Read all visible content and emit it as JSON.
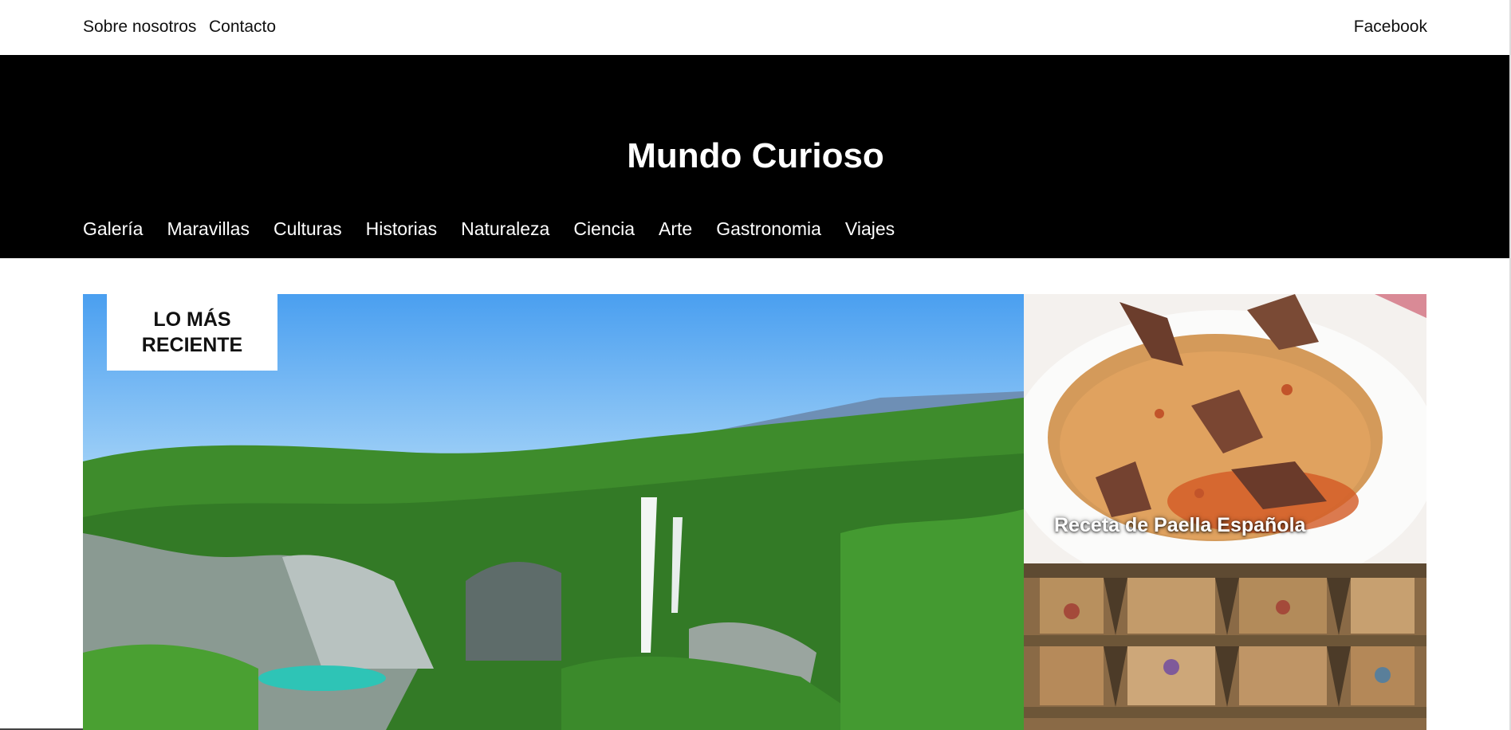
{
  "topbar": {
    "links": [
      "Sobre nosotros",
      "Contacto"
    ],
    "social": "Facebook"
  },
  "site": {
    "title": "Mundo Curioso"
  },
  "nav": [
    "Galería",
    "Maravillas",
    "Culturas",
    "Historias",
    "Naturaleza",
    "Ciencia",
    "Arte",
    "Gastronomia",
    "Viajes"
  ],
  "hero": {
    "badge": "LO MÁS RECIENTE",
    "image": "waterfall-forest-landscape"
  },
  "cards": [
    {
      "caption": "Receta de Paella Española",
      "image": "paella-dish"
    },
    {
      "caption": "",
      "image": "painted-ceiling-fresco"
    }
  ],
  "colors": {
    "header_bg": "#000000",
    "text_light": "#ffffff",
    "text_dark": "#111111"
  }
}
